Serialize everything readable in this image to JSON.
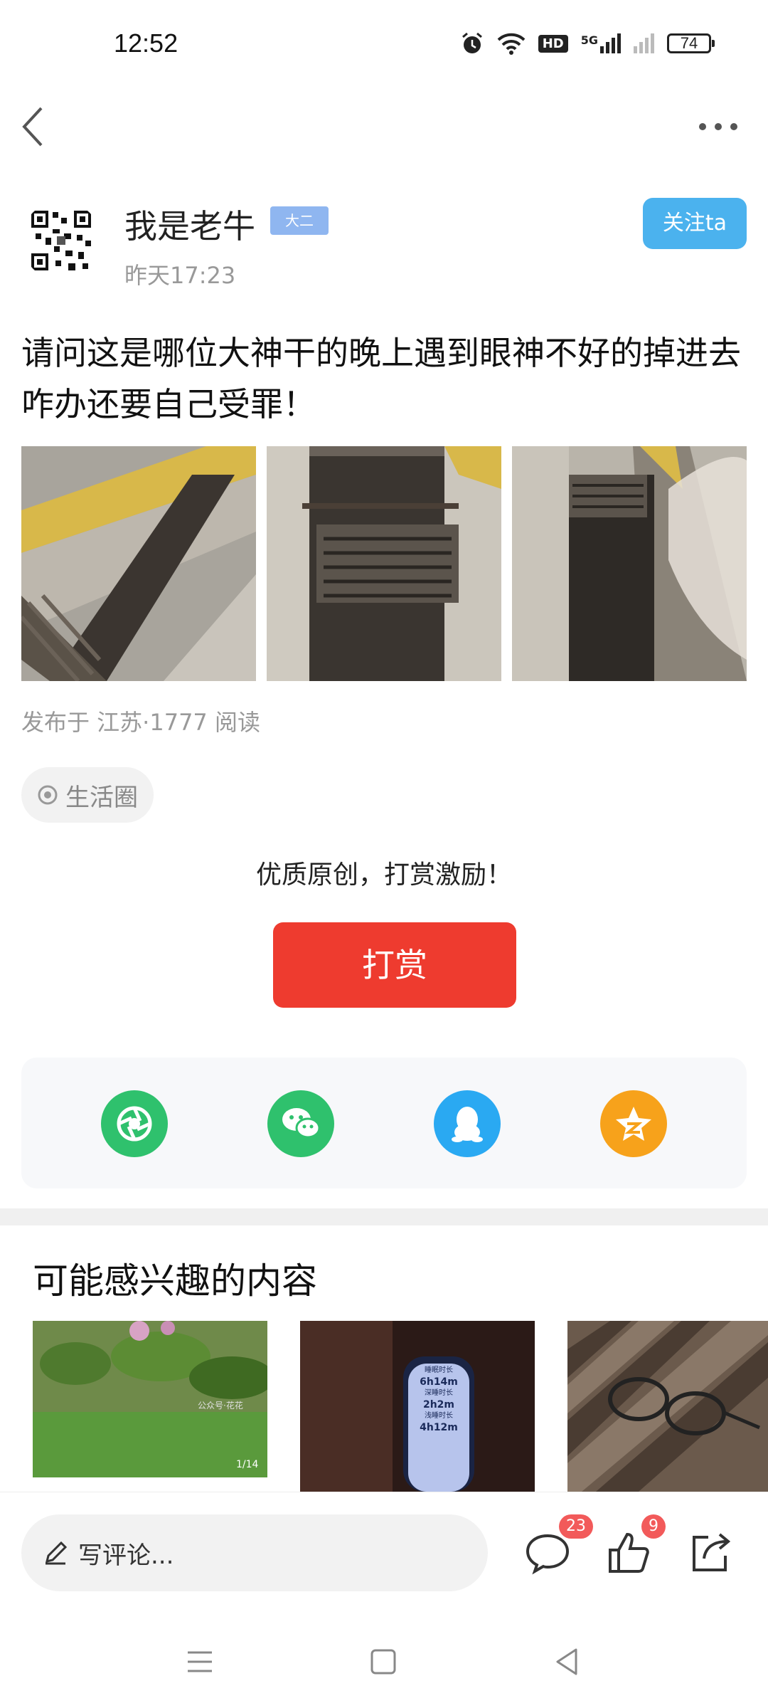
{
  "status_bar": {
    "time": "12:52",
    "battery": "74",
    "network": "5G",
    "hd_label": "HD"
  },
  "header": {
    "back_icon": "chevron-left-icon",
    "more_icon": "more-horizontal-icon"
  },
  "author": {
    "name": "我是老牛",
    "level_badge": "大二",
    "time": "昨天17:23",
    "follow_label": "关注ta"
  },
  "post": {
    "text": "请问这是哪位大神干的晚上遇到眼神不好的掉进去咋办还要自己受罪！",
    "meta": "发布于 江苏·1777 阅读",
    "tag": "生活圈"
  },
  "reward": {
    "prompt": "优质原创，打赏激励！",
    "button_label": "打赏"
  },
  "share": {
    "items": [
      {
        "name": "moments",
        "icon": "aperture-icon",
        "color": "#2fc16d"
      },
      {
        "name": "wechat",
        "icon": "wechat-icon",
        "color": "#2fc16d"
      },
      {
        "name": "qq",
        "icon": "penguin-icon",
        "color": "#2aa9f2"
      },
      {
        "name": "qzone",
        "icon": "star-icon",
        "color": "#f7a21b"
      }
    ]
  },
  "recommend": {
    "title": "可能感兴趣的内容",
    "cards": [
      {
        "overlay": "1/14",
        "watermark": "公众号·花花"
      },
      {
        "line1": "睡眠时长",
        "line2": "6h14m",
        "line3": "深睡时长",
        "line4": "2h2m",
        "line5": "浅睡时长",
        "line6": "4h12m"
      },
      {}
    ]
  },
  "bottom_bar": {
    "comment_placeholder": "写评论...",
    "comment_count": "23",
    "like_count": "9"
  },
  "colors": {
    "accent": "#4bb2ee",
    "reward": "#ee3b2f",
    "badge": "#f25a5a"
  }
}
